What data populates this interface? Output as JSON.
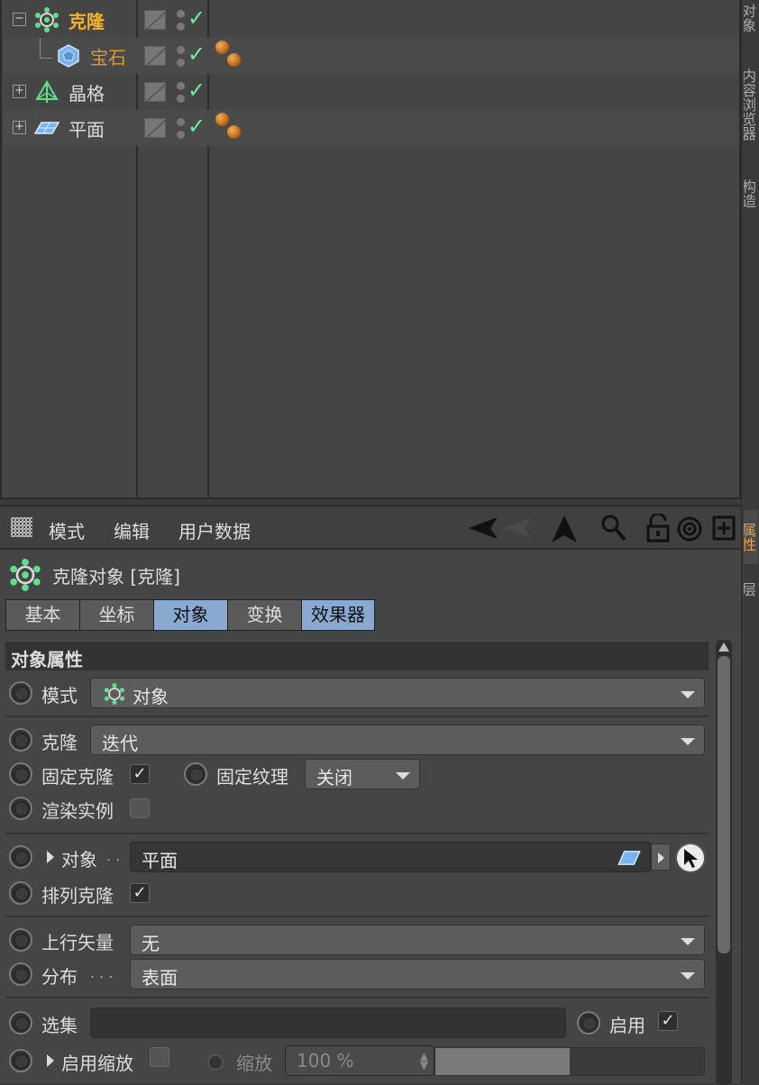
{
  "object_manager": {
    "objects": [
      {
        "name": "克隆",
        "icon": "cloner-icon",
        "expanded": true,
        "selected": true
      },
      {
        "name": "宝石",
        "icon": "platonic-icon",
        "child": true,
        "has_material": true
      },
      {
        "name": "晶格",
        "icon": "atom-array-icon",
        "expanded": false
      },
      {
        "name": "平面",
        "icon": "plane-icon",
        "expanded": false,
        "has_material": true
      }
    ]
  },
  "right_tabs": [
    "对象",
    "内容浏览器",
    "构造",
    "属性",
    "层"
  ],
  "attribute_manager": {
    "menu": {
      "mode": "模式",
      "edit": "编辑",
      "user_data": "用户数据"
    },
    "title": "克隆对象 [克隆]",
    "tabs": [
      "基本",
      "坐标",
      "对象",
      "变换",
      "效果器"
    ],
    "active_tab": "对象",
    "section_title": "对象属性",
    "props": {
      "mode_label": "模式",
      "mode_value": "对象",
      "clones_label": "克隆",
      "clones_value": "迭代",
      "fix_clone_label": "固定克隆",
      "fix_texture_label": "固定纹理",
      "fix_texture_value": "关闭",
      "render_instances_label": "渲染实例",
      "object_label": "对象",
      "object_value": "平面",
      "arrange_clones_label": "排列克隆",
      "up_vector_label": "上行矢量",
      "up_vector_value": "无",
      "distribution_label": "分布",
      "distribution_value": "表面",
      "selection_label": "选集",
      "enable_label": "启用",
      "enable_scale_label": "启用缩放",
      "scale_label": "缩放",
      "scale_value": "100 %",
      "dots": ". .",
      "dots3": ". . ."
    }
  },
  "colors": {
    "accent": "#f0a040",
    "active_tab": "#8aa9d0",
    "check": "#6cf0a0"
  }
}
